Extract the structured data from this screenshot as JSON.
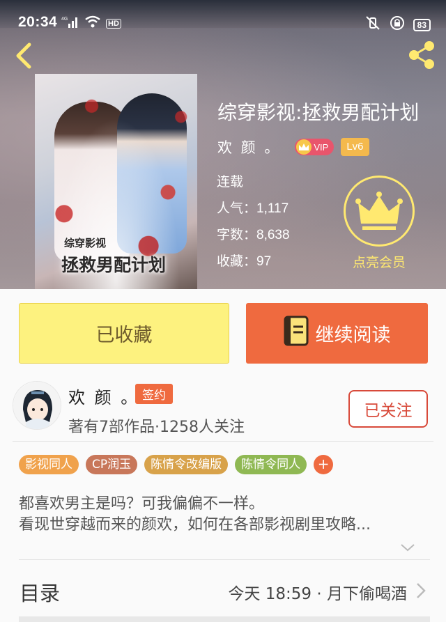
{
  "status_bar": {
    "time": "20:34",
    "network": "4G",
    "hd": "HD",
    "battery": "83"
  },
  "book": {
    "title": "综穿影视:拯救男配计划",
    "author": "欢 颜 。",
    "vip_label": "VIP",
    "level": "Lv6",
    "status": "连载",
    "stats": [
      {
        "label": "人气：",
        "value": "1,117"
      },
      {
        "label": "字数：",
        "value": "8,638"
      },
      {
        "label": "收藏：",
        "value": "97"
      }
    ],
    "cover": {
      "subtitle": "综穿影视",
      "title": "拯救男配计划"
    }
  },
  "member": {
    "label": "点亮会员"
  },
  "actions": {
    "favorite_label": "已收藏",
    "read_label": "继续阅读"
  },
  "author_card": {
    "name": "欢 颜 。",
    "badge": "签约",
    "meta": "著有7部作品·1258人关注",
    "follow_label": "已关注"
  },
  "tags": [
    {
      "label": "影视同人",
      "color": "#f0a24c"
    },
    {
      "label": "CP润玉",
      "color": "#c8775a"
    },
    {
      "label": "陈情令改编版",
      "color": "#d8a24a"
    },
    {
      "label": "陈情令同人",
      "color": "#8fb853"
    }
  ],
  "tag_more": "+",
  "description": [
    "都喜欢男主是吗？可我偏偏不一样。",
    "看现世穿越而来的颜欢，如何在各部影视剧里攻略..."
  ],
  "toc": {
    "label": "目录",
    "latest": "今天 18:59 · 月下偷喝酒"
  },
  "colors": {
    "accent_orange": "#ef6a3f",
    "favorite_yellow": "#fdf27f",
    "member_gold": "#ffe970"
  }
}
